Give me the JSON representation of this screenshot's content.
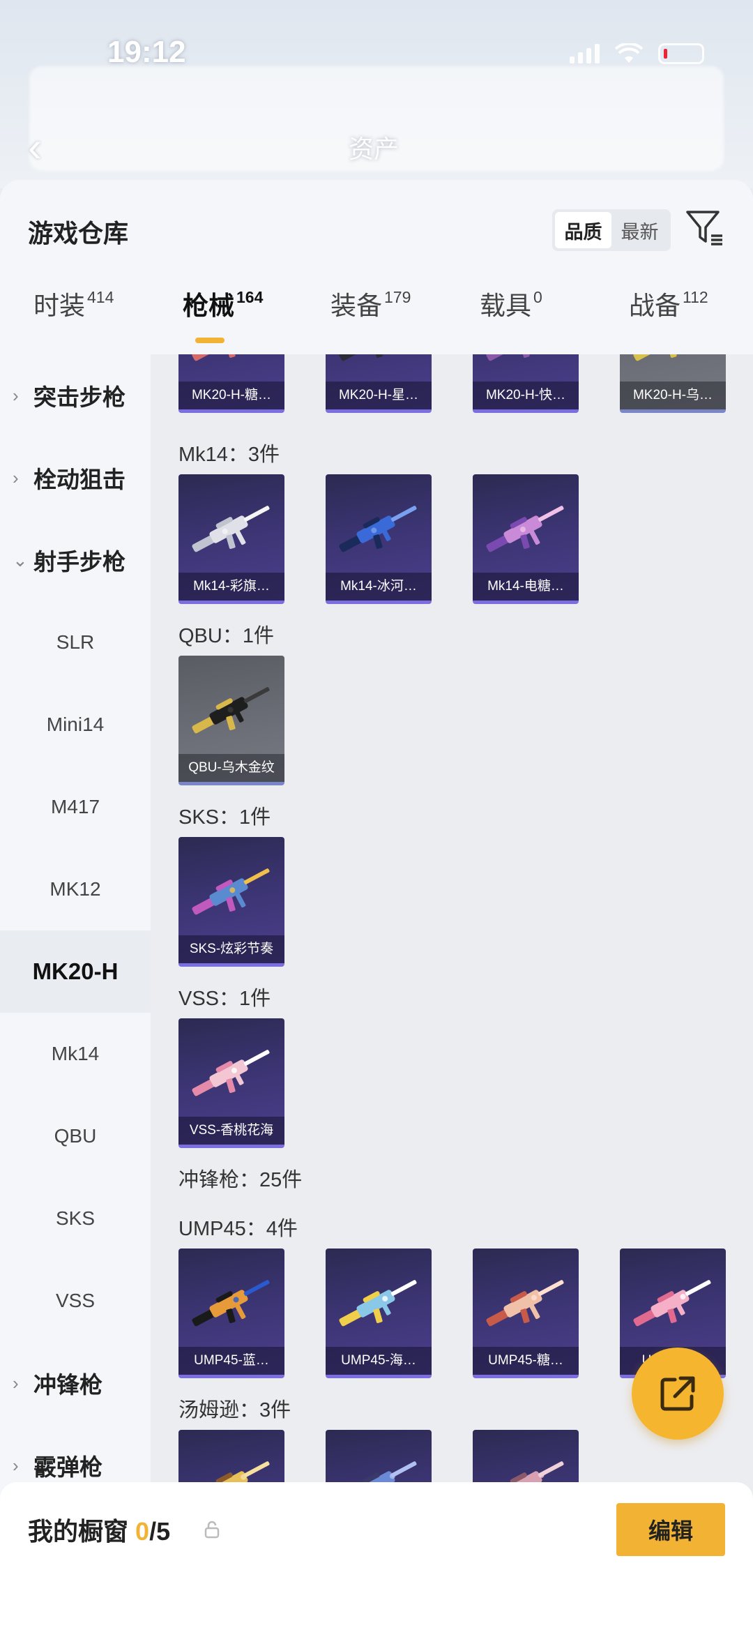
{
  "status_bar": {
    "time": "19:12"
  },
  "background": {
    "back_glyph": "‹",
    "title": "资产"
  },
  "sheet": {
    "title": "游戏仓库"
  },
  "sort": {
    "options": [
      "品质",
      "最新"
    ],
    "active_index": 0
  },
  "tabs": [
    {
      "label": "时装",
      "count": "414"
    },
    {
      "label": "枪械",
      "count": "164"
    },
    {
      "label": "装备",
      "count": "179"
    },
    {
      "label": "载具",
      "count": "0"
    },
    {
      "label": "战备",
      "count": "112"
    }
  ],
  "active_tab": 1,
  "left_nav": {
    "items": [
      {
        "label": "突击步枪",
        "type": "category",
        "chevron": "›"
      },
      {
        "label": "栓动狙击",
        "type": "category",
        "chevron": "›"
      },
      {
        "label": "射手步枪",
        "type": "category",
        "chevron": "⌄"
      },
      {
        "label": "SLR",
        "type": "sub"
      },
      {
        "label": "Mini14",
        "type": "sub"
      },
      {
        "label": "M417",
        "type": "sub"
      },
      {
        "label": "MK12",
        "type": "sub"
      },
      {
        "label": "MK20-H",
        "type": "sub",
        "active": true
      },
      {
        "label": "Mk14",
        "type": "sub"
      },
      {
        "label": "QBU",
        "type": "sub"
      },
      {
        "label": "SKS",
        "type": "sub"
      },
      {
        "label": "VSS",
        "type": "sub"
      },
      {
        "label": "冲锋枪",
        "type": "category",
        "chevron": "›"
      },
      {
        "label": "霰弹枪",
        "type": "category",
        "chevron": "›"
      }
    ]
  },
  "content": {
    "top_partial_cards": [
      "MK20-H-糖…",
      "MK20-H-星…",
      "MK20-H-快…",
      "MK20-H-乌…"
    ],
    "groups": [
      {
        "label": "Mk14：3件",
        "cards": [
          "Mk14-彩旗…",
          "Mk14-冰河…",
          "Mk14-电糖…"
        ]
      },
      {
        "label": "QBU：1件",
        "cards": [
          "QBU-乌木金纹"
        ]
      },
      {
        "label": "SKS：1件",
        "cards": [
          "SKS-炫彩节奏"
        ]
      },
      {
        "label": "VSS：1件",
        "cards": [
          "VSS-香桃花海"
        ]
      },
      {
        "label": "冲锋枪：25件",
        "cards": []
      },
      {
        "label": "UMP45：4件",
        "cards": [
          "UMP45-蓝…",
          "UMP45-海…",
          "UMP45-糖…",
          "UMP45-…"
        ]
      },
      {
        "label": "汤姆逊：3件",
        "cards": [
          "",
          "",
          ""
        ]
      }
    ]
  },
  "bottom": {
    "showcase_label": "我的橱窗",
    "showcase_current": "0",
    "showcase_total": "/5",
    "edit_label": "编辑"
  },
  "colors": {
    "accent": "#f2b233",
    "card_purple": "#3b3472",
    "card_gray": "#6d6f78"
  }
}
